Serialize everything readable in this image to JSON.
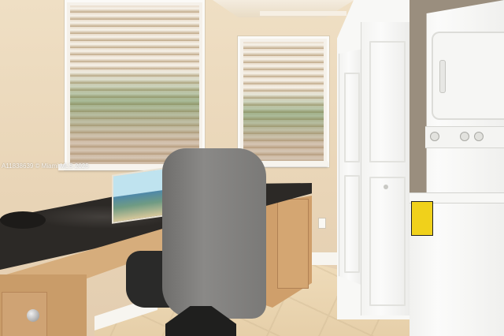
{
  "watermark": {
    "text": "A11838639 © Miami MLS 2025"
  },
  "scene": {
    "description_tags": [
      "window-blinds",
      "desk",
      "office-chair",
      "closet-bifold-doors",
      "stacked-washer-dryer",
      "tile-floor"
    ]
  },
  "colors": {
    "wall": "#e9d5b7",
    "countertop": "#2c2926",
    "cabinet_wood": "#d4a672",
    "chair": "#7a7977",
    "appliance": "#f3f3f1",
    "warning_label": "#f0d11b"
  }
}
